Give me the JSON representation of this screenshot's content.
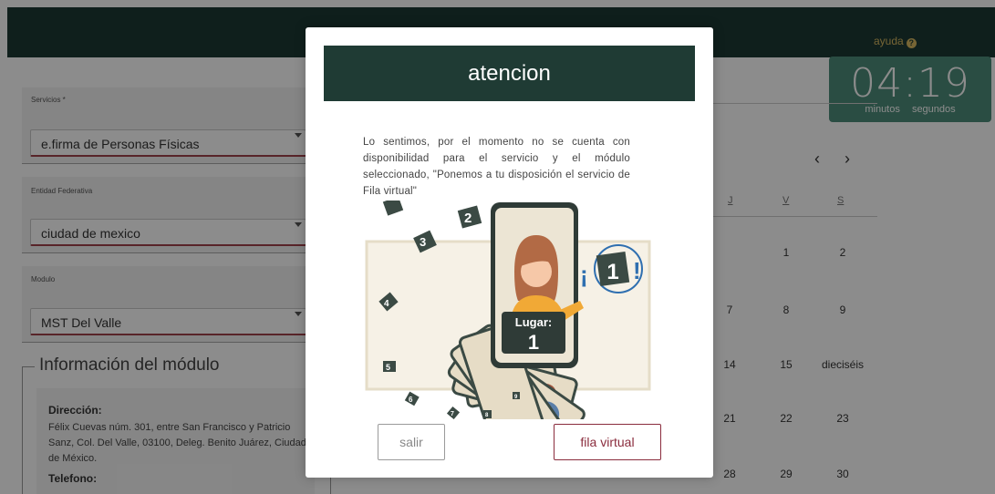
{
  "header": {
    "help_label": "ayuda"
  },
  "timer": {
    "time": "04:19",
    "minutes_label": "minutos",
    "seconds_label": "segundos"
  },
  "form": {
    "servicios": {
      "label": "Servicios *",
      "value": "e.firma de Personas Físicas"
    },
    "entidad": {
      "label": "Entidad Federativa",
      "value": "ciudad de mexico"
    },
    "modulo": {
      "label": "Modulo",
      "value": "MST Del Valle"
    }
  },
  "module_info": {
    "legend": "Información del módulo",
    "address_title": "Dirección:",
    "address": "Félix Cuevas núm. 301, entre San Francisco y Patricio Sanz, Col. Del Valle, 03100, Deleg. Benito Juárez, Ciudad de México.",
    "phone_title": "Telefono:"
  },
  "calendar": {
    "prev": "‹",
    "next": "›",
    "weekday_headers": [
      "J",
      "V",
      "S"
    ],
    "rows": [
      [
        "",
        "1",
        "2"
      ],
      [
        "7",
        "8",
        "9"
      ],
      [
        "14",
        "15",
        "dieciséis"
      ],
      [
        "21",
        "22",
        "23"
      ],
      [
        "28",
        "29",
        "30"
      ]
    ]
  },
  "modal": {
    "title": "atencion",
    "message": "Lo sentimos, por el momento no se cuenta con disponibilidad para el servicio y el módulo seleccionado, \"Ponemos a tu disposición el servicio de Fila virtual\"",
    "illustration": {
      "place_label": "Lugar:",
      "place_number": "1",
      "badge_number": "1",
      "card_numbers": [
        "2",
        "3",
        "4",
        "5",
        "6",
        "7",
        "8",
        "9"
      ]
    },
    "cancel_label": "salir",
    "confirm_label": "fila virtual"
  },
  "colors": {
    "header_bg": "#1c3a33",
    "accent_gold": "#d8b862",
    "timer_bg": "#4e8d7a",
    "accent_wine": "#8a2c3d"
  }
}
